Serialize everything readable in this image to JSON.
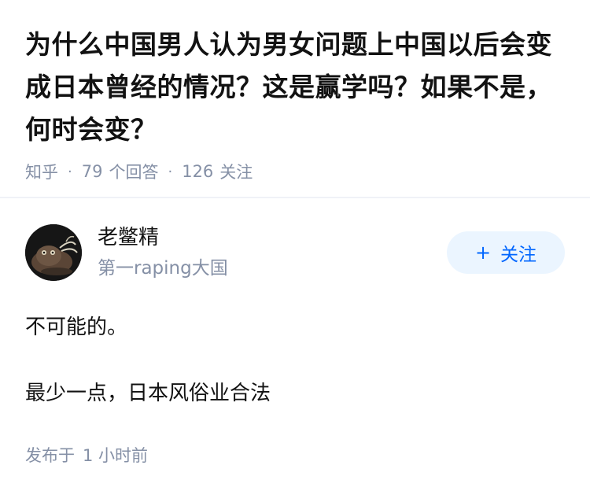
{
  "question": {
    "title": "为什么中国男人认为男女问题上中国以后会变成日本曾经的情况？这是赢学吗？如果不是，何时会变？",
    "source": "知乎",
    "answer_count": "79",
    "answer_label": "个回答",
    "follow_count": "126",
    "follow_label": "关注"
  },
  "answer": {
    "author_name": "老鳖精",
    "author_bio": "第一raping大国",
    "avatar_icon": "avatar-illustration",
    "follow_button_label": "关注",
    "follow_button_icon": "plus-icon",
    "paragraphs": [
      "不可能的。",
      "最少一点，日本风俗业合法"
    ],
    "published_label": "发布于",
    "published_time": "1 小时前"
  },
  "colors": {
    "text": "#121212",
    "meta": "#8590a6",
    "accent": "#0066ff",
    "button_bg": "#ebf5ff",
    "divider": "#f0f2f7"
  }
}
